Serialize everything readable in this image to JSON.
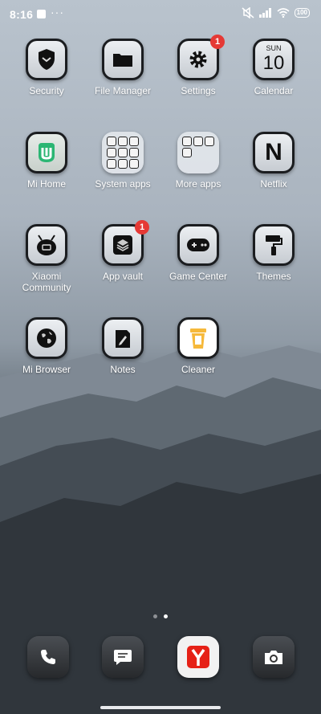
{
  "status_bar": {
    "time": "8:16",
    "more": "···",
    "battery": "100"
  },
  "apps": [
    {
      "label": "Security",
      "icon": "shield-icon"
    },
    {
      "label": "File Manager",
      "icon": "folder-icon"
    },
    {
      "label": "Settings",
      "icon": "gear-icon",
      "badge": "1"
    },
    {
      "label": "Calendar",
      "icon": "calendar-icon",
      "month": "SUN",
      "day": "10"
    },
    {
      "label": "Mi Home",
      "icon": "mi-home-icon"
    },
    {
      "label": "System apps",
      "icon": "folder-grid-icon"
    },
    {
      "label": "More apps",
      "icon": "folder-grid-icon"
    },
    {
      "label": "Netflix",
      "icon": "netflix-icon",
      "glyph": "N"
    },
    {
      "label": "Xiaomi Community",
      "icon": "community-icon"
    },
    {
      "label": "App vault",
      "icon": "layers-icon",
      "badge": "1"
    },
    {
      "label": "Game Center",
      "icon": "gamepad-icon"
    },
    {
      "label": "Themes",
      "icon": "paint-roller-icon"
    },
    {
      "label": "Mi Browser",
      "icon": "globe-icon"
    },
    {
      "label": "Notes",
      "icon": "notes-icon"
    },
    {
      "label": "Cleaner",
      "icon": "trash-icon"
    }
  ],
  "dock": [
    {
      "icon": "phone-icon"
    },
    {
      "icon": "messages-icon"
    },
    {
      "icon": "yandex-browser-icon"
    },
    {
      "icon": "camera-icon"
    }
  ],
  "page_indicator": {
    "pages": 2,
    "current": 2
  }
}
